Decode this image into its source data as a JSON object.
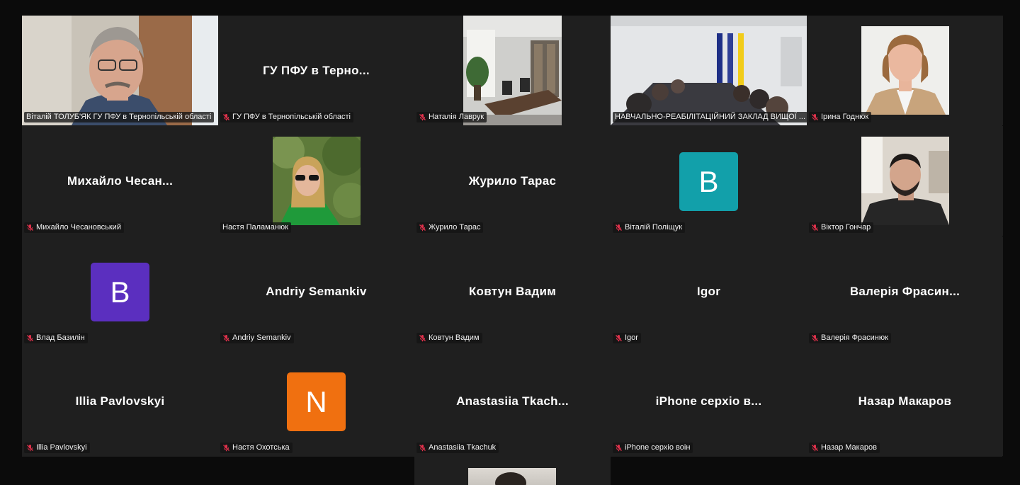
{
  "tiles": [
    {
      "name": "Віталій ТОЛУБ'ЯК ГУ ПФУ в Тернопільській області",
      "display": "",
      "muted": false,
      "kind": "video",
      "variant": "man-office",
      "active": true
    },
    {
      "name": "ГУ ПФУ в Тернопільській області",
      "display": "ГУ ПФУ в Терно...",
      "muted": true,
      "kind": "text"
    },
    {
      "name": "Наталія Лаврук",
      "display": "",
      "muted": true,
      "kind": "video",
      "variant": "meeting-room"
    },
    {
      "name": "НАВЧАЛЬНО-РЕАБІЛІТАЦІЙНИЙ ЗАКЛАД ВИЩОЇ ...",
      "display": "",
      "muted": false,
      "kind": "video",
      "variant": "conference"
    },
    {
      "name": "Ірина Годнюк",
      "display": "",
      "muted": true,
      "kind": "video",
      "variant": "woman-portrait"
    },
    {
      "name": "Михайло Чесановський",
      "display": "Михайло  Чесан...",
      "muted": true,
      "kind": "text"
    },
    {
      "name": "Настя Паламанюк",
      "display": "",
      "muted": false,
      "kind": "video",
      "variant": "woman-outdoor"
    },
    {
      "name": "Журило Тарас",
      "display": "Журило Тарас",
      "muted": true,
      "kind": "text"
    },
    {
      "name": "Віталій Поліщук",
      "display": "",
      "muted": true,
      "kind": "letter",
      "letter": "B",
      "color": "#12a0aa"
    },
    {
      "name": "Віктор Гончар",
      "display": "",
      "muted": true,
      "kind": "video",
      "variant": "man-room"
    },
    {
      "name": "Влад Базилін",
      "display": "",
      "muted": true,
      "kind": "letter",
      "letter": "B",
      "color": "#5b2fbf"
    },
    {
      "name": "Andriy Semankiv",
      "display": "Andriy Semankiv",
      "muted": true,
      "kind": "text"
    },
    {
      "name": "Ковтун Вадим",
      "display": "Ковтун Вадим",
      "muted": true,
      "kind": "text"
    },
    {
      "name": "Igor",
      "display": "Igor",
      "muted": true,
      "kind": "text"
    },
    {
      "name": "Валерія Фрасинюк",
      "display": "Валерія  Фрасин...",
      "muted": true,
      "kind": "text"
    },
    {
      "name": "Illia Pavlovskyi",
      "display": "Illia Pavlovskyi",
      "muted": true,
      "kind": "text"
    },
    {
      "name": "Настя Охотська",
      "display": "",
      "muted": true,
      "kind": "letter",
      "letter": "N",
      "color": "#f07010"
    },
    {
      "name": "Anastasiia Tkachuk",
      "display": "Anastasiia  Tkach...",
      "muted": true,
      "kind": "text"
    },
    {
      "name": "iPhone серхіо воін",
      "display": "iPhone  серхіо  в...",
      "muted": true,
      "kind": "text"
    },
    {
      "name": "Назар Макаров",
      "display": "Назар Макаров",
      "muted": true,
      "kind": "text"
    }
  ],
  "colors": {
    "active_border": "#2fd17c",
    "muted_icon": "#e0314b",
    "tile_bg": "#1f1f1f",
    "page_bg": "#0b0b0b"
  }
}
